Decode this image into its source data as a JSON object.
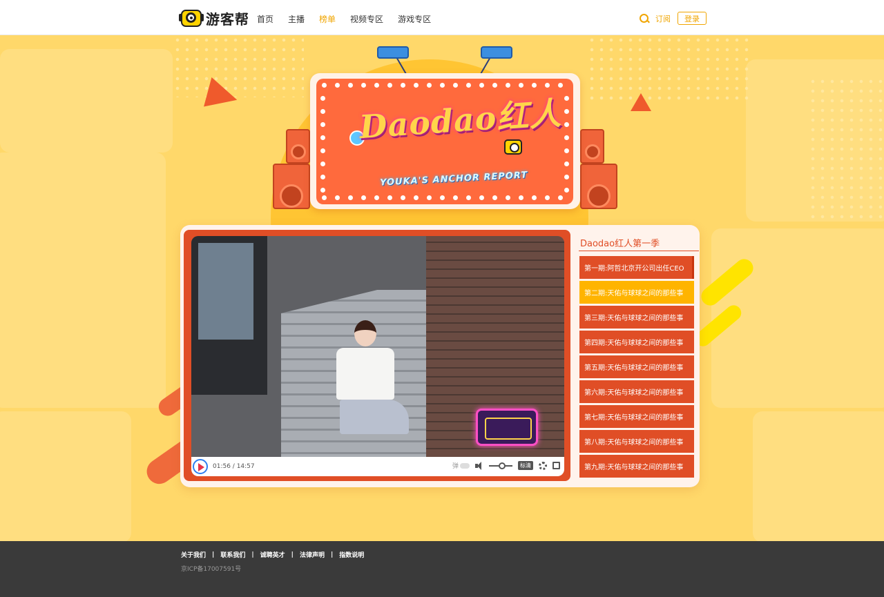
{
  "header": {
    "logo_text": "游客帮",
    "nav": [
      {
        "label": "首页",
        "active": false
      },
      {
        "label": "主播",
        "active": false
      },
      {
        "label": "榜单",
        "active": true
      },
      {
        "label": "视频专区",
        "active": false
      },
      {
        "label": "游戏专区",
        "active": false
      }
    ],
    "search_icon": "search-icon",
    "subscribe_label": "订阅",
    "login_label": "登录"
  },
  "banner": {
    "title": "Daodao红人",
    "subtitle": "YOUKA'S ANCHOR REPORT"
  },
  "player": {
    "time": "01:56 / 14:57",
    "danmu_label": "弹",
    "quality_label": "标清"
  },
  "playlist": {
    "title": "Daodao红人第一季",
    "items": [
      {
        "label": "第一期:阿哲北京开公司出任CEO",
        "active": false
      },
      {
        "label": "第二期:天佑与球球之间的那些事",
        "active": true
      },
      {
        "label": "第三期:天佑与球球之间的那些事",
        "active": false
      },
      {
        "label": "第四期:天佑与球球之间的那些事",
        "active": false
      },
      {
        "label": "第五期:天佑与球球之间的那些事",
        "active": false
      },
      {
        "label": "第六期:天佑与球球之间的那些事",
        "active": false
      },
      {
        "label": "第七期:天佑与球球之间的那些事",
        "active": false
      },
      {
        "label": "第八期:天佑与球球之间的那些事",
        "active": false
      },
      {
        "label": "第九期:天佑与球球之间的那些事",
        "active": false
      }
    ]
  },
  "footer": {
    "links": [
      "关于我们",
      "联系我们",
      "诚聘英才",
      "法律声明",
      "指数说明"
    ],
    "icp": "京ICP备17007591号"
  },
  "colors": {
    "accent": "#f0a500",
    "brand_red": "#e04e26",
    "active_item": "#ffb400",
    "background": "#ffd86a",
    "footer_bg": "#3a3a3a"
  }
}
